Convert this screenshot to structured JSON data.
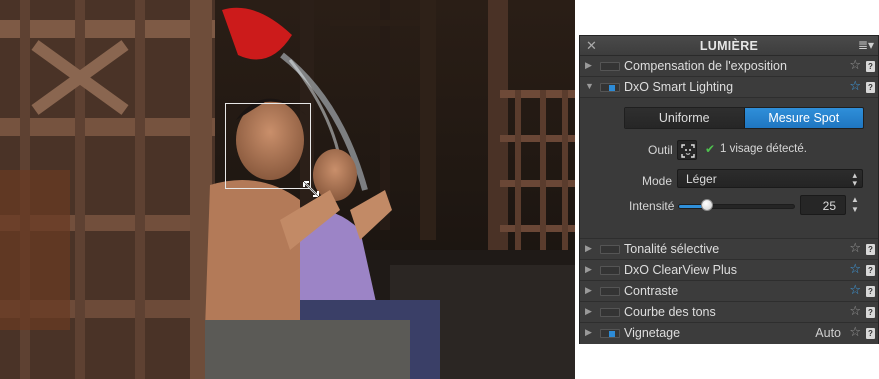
{
  "panel": {
    "title": "LUMIÈRE",
    "close_glyph": "✕",
    "menu_glyph": "≣▾"
  },
  "rows_top": [
    {
      "label": "Compensation de l'exposition",
      "arrow": "▶",
      "enabled": false,
      "star": "outline",
      "star_glyph": "☆",
      "help": "?"
    },
    {
      "label": "DxO Smart Lighting",
      "arrow": "▼",
      "enabled": true,
      "star": "blue-outline",
      "star_glyph": "☆",
      "help": "?"
    }
  ],
  "smart_lighting": {
    "segment": {
      "uniform": "Uniforme",
      "spot": "Mesure Spot",
      "selected": "Mesure Spot"
    },
    "tool_label": "Outil",
    "tool_icon": "face-detect-icon",
    "check_glyph": "✔",
    "detection_text": "1 visage détecté.",
    "mode_label": "Mode",
    "mode_value": "Léger",
    "mode_arrows": "▴\n▾",
    "intensity_label": "Intensité",
    "intensity_value": "25",
    "intensity_fraction": 0.25,
    "stepper_up": "▲",
    "stepper_down": "▼"
  },
  "rows_bottom": [
    {
      "label": "Tonalité sélective",
      "arrow": "▶",
      "enabled": false,
      "star": "outline",
      "star_glyph": "☆",
      "help": "?",
      "auto": ""
    },
    {
      "label": "DxO ClearView Plus",
      "arrow": "▶",
      "enabled": false,
      "star": "blue-outline",
      "star_glyph": "☆",
      "help": "?",
      "auto": ""
    },
    {
      "label": "Contraste",
      "arrow": "▶",
      "enabled": false,
      "star": "blue-outline",
      "star_glyph": "☆",
      "help": "?",
      "auto": ""
    },
    {
      "label": "Courbe des tons",
      "arrow": "▶",
      "enabled": false,
      "star": "outline",
      "star_glyph": "☆",
      "help": "?",
      "auto": ""
    },
    {
      "label": "Vignetage",
      "arrow": "▶",
      "enabled": true,
      "star": "outline",
      "star_glyph": "☆",
      "help": "?",
      "auto": "Auto"
    }
  ],
  "colors": {
    "accent": "#2f8fd9",
    "panel_bg": "#3b3b3b",
    "check_green": "#4ec24e"
  }
}
